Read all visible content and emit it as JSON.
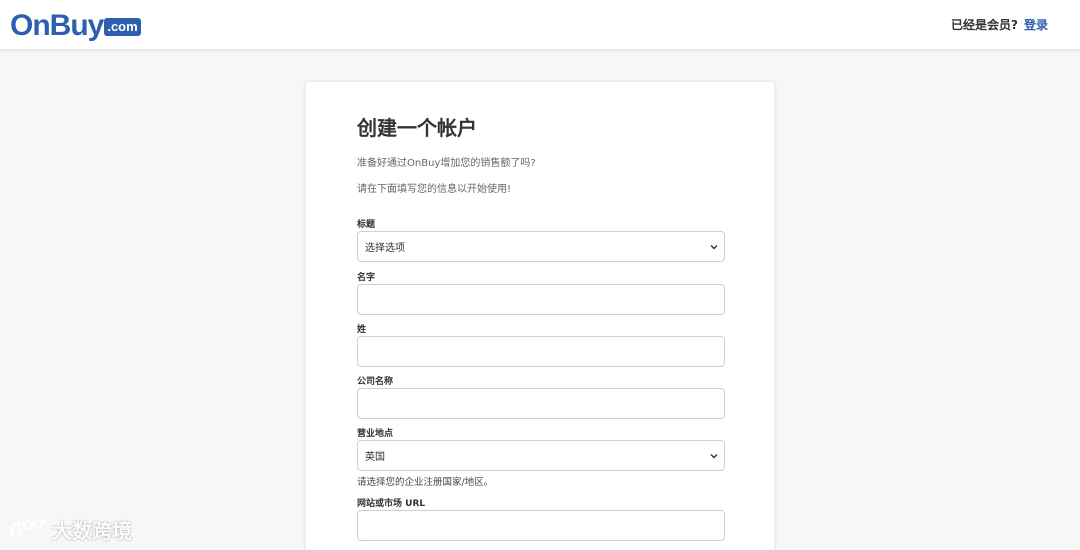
{
  "header": {
    "logo_main": "OnBuy",
    "logo_dotcom": ".com",
    "member_question": "已经是会员?",
    "login_link": "登录"
  },
  "form": {
    "title": "创建一个帐户",
    "intro_line1": "准备好通过OnBuy增加您的销售额了吗?",
    "intro_line2": "请在下面填写您的信息以开始使用!",
    "fields": {
      "title_label": "标题",
      "title_select_value": "选择选项",
      "first_name_label": "名字",
      "first_name_value": "",
      "last_name_label": "姓",
      "last_name_value": "",
      "company_label": "公司名称",
      "company_value": "",
      "business_location_label": "营业地点",
      "business_location_value": "英国",
      "business_location_hint": "请选择您的企业注册国家/地区。",
      "website_label": "网站或市场 URL",
      "website_value": ""
    }
  },
  "watermark": {
    "text": "大数跨境"
  },
  "colors": {
    "brand": "#2d5fae",
    "background": "#f7f7f7",
    "card": "#ffffff"
  }
}
